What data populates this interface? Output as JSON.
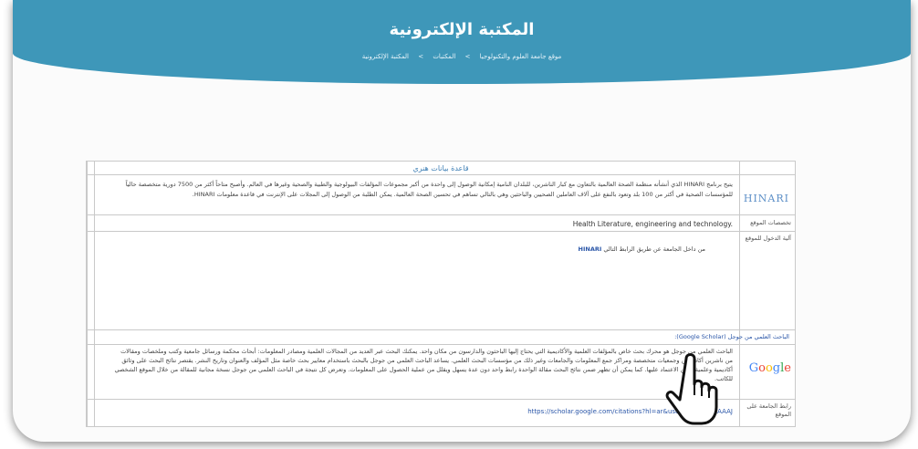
{
  "banner": {
    "title": "المكتبة الإلكترونية",
    "breadcrumb": [
      "موقع جامعة العلوم والتكنولوجيا",
      ">",
      "المكتبات",
      ">",
      "المكتبة الإلكترونية"
    ]
  },
  "table": {
    "heading": "قاعدة بيانات هنري",
    "hinari": {
      "logo": "HINARI",
      "description": "يتيح برنامج HINARI الذي أنشأته منظمة الصحة العالمية بالتعاون مع كبار الناشرين، للبلدان النامية إمكانية الوصول إلى واحدة من أكبر مجموعات المؤلفات البيولوجية والطبية والصحية وغيرها في العالم. وأصبح متاحاً أكثر من 7500 دورية متخصصة حالياً للمؤسسات الصحية في أكثر من 100 بلد وتعود بالنفع على آلاف العاملين الصحيين والباحثين وهي بالتالي تساهم في تحسين الصحة العالمية. يمكن الطلبة من الوصول إلى المجلات على الإنترنت في قاعدة معلومات HINARI.",
      "subjects_label": "تخصصات الموقع",
      "subjects": "Health Literature, engineering and technology.",
      "access_label": "آلية الدخول للموقع",
      "access_text": "من داخل الجامعة عن طريق الرابط التالي",
      "access_link": "HINARI"
    },
    "scholar": {
      "title": "الباحث العلمي من جوجل (Google Scholar):",
      "logo": "Google",
      "description": "الباحث العلمي من جوجل هو محرك بحث خاص بالمؤلفات العلمية والأكاديمية التي يحتاج إليها الباحثون والدارسون من مكان واحد. يمكنك البحث عبر العديد من المجالات العلمية ومصادر المعلومات: أبحاث محكمة ورسائل جامعية وكتب وملخصات ومقالات من ناشرين أكاديميين وجمعيات متخصصة ومراكز جمع المعلومات والجامعات وغير ذلك من مؤسسات البحث العلمي. يساعد الباحث العلمي من جوجل بالبحث باستخدام معايير بحث خاصة مثل المؤلف والعنوان وتاريخ النشر. يقتصر نتائج البحث على وثائق أكاديمية وعلمية يمكن الاعتماد عليها. كما يمكن أن تظهر ضمن نتائج البحث مقالة الواحدة رابط واحد دون عدة يسهل ويقلل من عملية الحصول على المعلومات. وتعرض كل نتيجة في الباحث العلمي من جوجل نسخة مجانية للمقالة من خلال الموقع الشخصي للكاتب.",
      "link_label": "رابط الجامعة على الموقع",
      "url": "https://scholar.google.com/citations?hl=ar&user=-e1z6P4AAAAJ"
    }
  },
  "colors": {
    "banner": "#3e97b9",
    "link": "#2a56a8"
  }
}
